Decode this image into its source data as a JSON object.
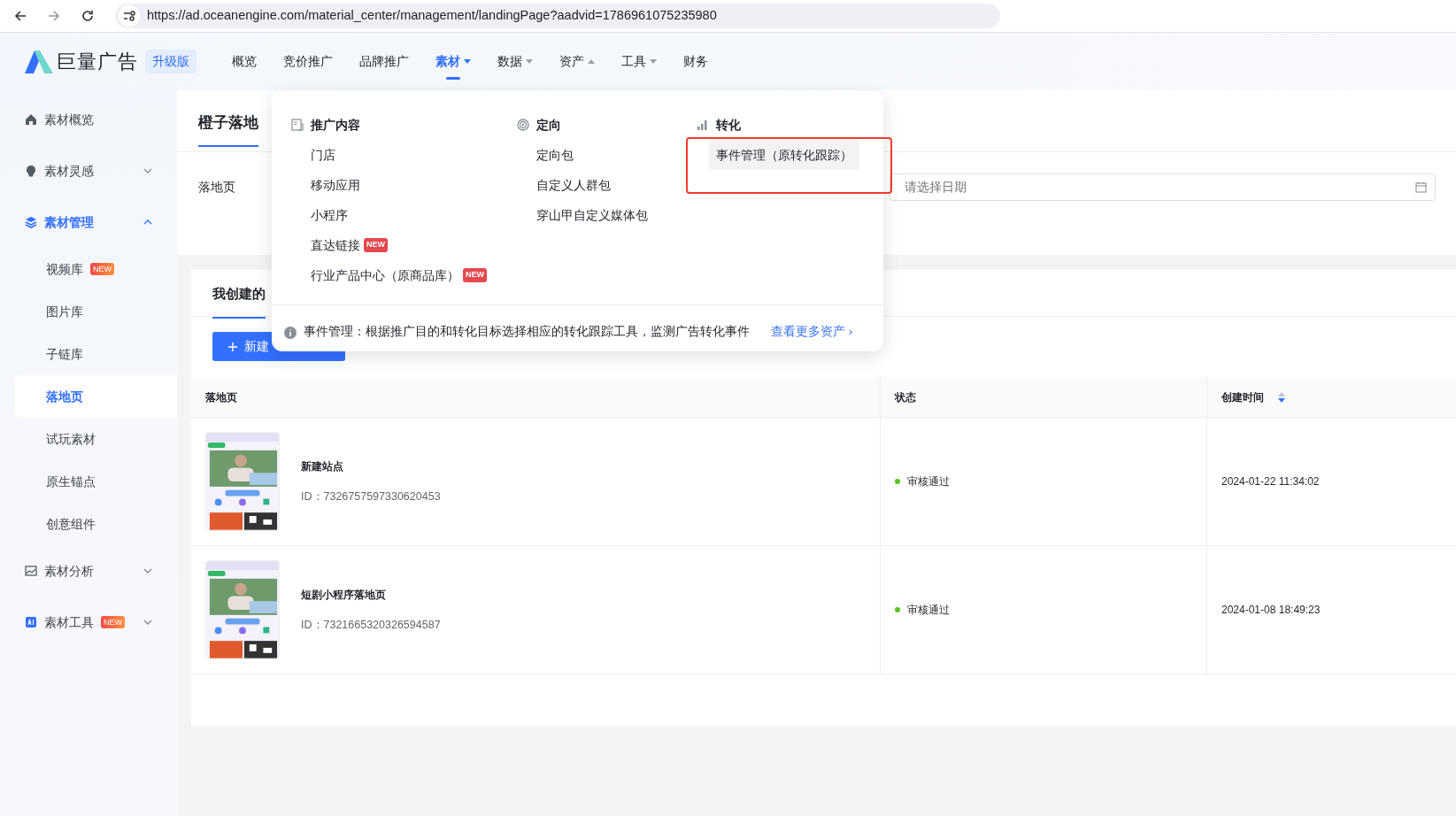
{
  "browser": {
    "url": "https://ad.oceanengine.com/material_center/management/landingPage?aadvid=1786961075235980"
  },
  "header": {
    "brand": "巨量广告",
    "edition": "升级版",
    "nav": [
      {
        "label": "概览",
        "selected": false,
        "has_dropdown": false
      },
      {
        "label": "竞价推广",
        "selected": false,
        "has_dropdown": false
      },
      {
        "label": "品牌推广",
        "selected": false,
        "has_dropdown": false
      },
      {
        "label": "素材",
        "selected": true,
        "has_dropdown": true,
        "caret_up": false
      },
      {
        "label": "数据",
        "selected": false,
        "has_dropdown": true,
        "caret_up": false
      },
      {
        "label": "资产",
        "selected": false,
        "has_dropdown": true,
        "caret_up": true
      },
      {
        "label": "工具",
        "selected": false,
        "has_dropdown": true,
        "caret_up": false
      },
      {
        "label": "财务",
        "selected": false,
        "has_dropdown": false
      }
    ]
  },
  "sidebar": {
    "items": [
      {
        "label": "素材概览",
        "selected": false
      },
      {
        "label": "素材灵感",
        "expanded": false,
        "selected": false
      },
      {
        "label": "素材管理",
        "expanded": true,
        "selected": true,
        "children": [
          {
            "label": "视频库",
            "badge": "NEW",
            "selected": false
          },
          {
            "label": "图片库",
            "selected": false
          },
          {
            "label": "子链库",
            "selected": false
          },
          {
            "label": "落地页",
            "selected": true
          },
          {
            "label": "试玩素材",
            "selected": false
          },
          {
            "label": "原生锚点",
            "selected": false
          },
          {
            "label": "创意组件",
            "selected": false
          }
        ]
      },
      {
        "label": "素材分析",
        "expanded": false,
        "selected": false
      },
      {
        "label": "素材工具",
        "badge": "NEW",
        "expanded": false,
        "selected": false
      }
    ]
  },
  "page": {
    "title": "橙子落地",
    "filter_label": "落地页",
    "date_field": {
      "placeholder": "请选择日期"
    },
    "tab": "我创建的",
    "new_button": "新建",
    "table": {
      "columns": [
        "落地页",
        "状态",
        "创建时间"
      ],
      "rows": [
        {
          "name": "新建站点",
          "id": "ID：7326757597330620453",
          "status": "审核通过",
          "color": "#52c41a",
          "created": "2024-01-22 11:34:02"
        },
        {
          "name": "短剧小程序落地页",
          "id": "ID：7321665320326594587",
          "status": "审核通过",
          "color": "#52c41a",
          "created": "2024-01-08 18:49:23"
        }
      ]
    }
  },
  "menu": {
    "columns": [
      {
        "title": "推广内容",
        "items": [
          {
            "label": "门店",
            "highlighted": false,
            "outlined": false
          },
          {
            "label": "移动应用",
            "highlighted": false,
            "outlined": false
          },
          {
            "label": "小程序",
            "highlighted": false,
            "outlined": false
          },
          {
            "label": "直达链接",
            "badge": "NEW",
            "highlighted": false,
            "outlined": false
          },
          {
            "label": "行业产品中心（原商品库）",
            "badge": "NEW",
            "highlighted": false,
            "outlined": false
          }
        ]
      },
      {
        "title": "定向",
        "items": [
          {
            "label": "定向包",
            "highlighted": false,
            "outlined": false
          },
          {
            "label": "自定义人群包",
            "highlighted": false,
            "outlined": false
          },
          {
            "label": "穿山甲自定义媒体包",
            "highlighted": false,
            "outlined": false
          }
        ]
      },
      {
        "title": "转化",
        "items": [
          {
            "label": "事件管理（原转化跟踪）",
            "highlighted": true,
            "outlined": true
          }
        ]
      }
    ],
    "footer": {
      "note": "事件管理：根据推广目的和转化目标选择相应的转化跟踪工具，监测广告转化事件",
      "link": "查看更多资产 ›"
    }
  }
}
